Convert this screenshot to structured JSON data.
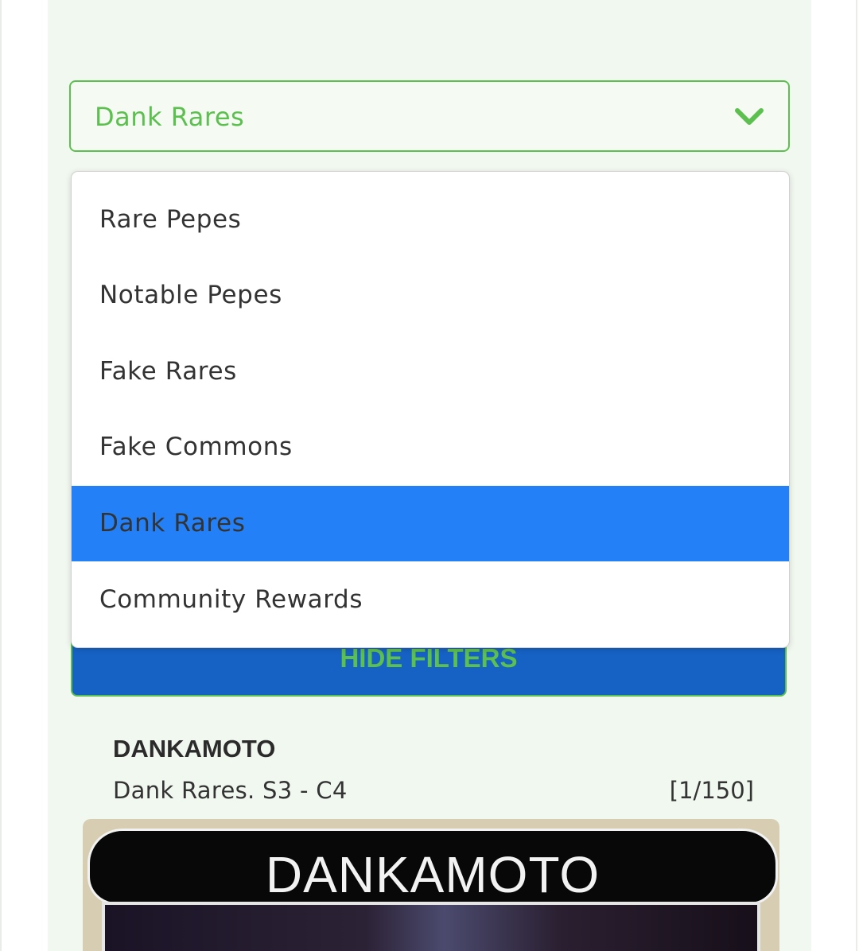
{
  "filter_select": {
    "selected": "Dank Rares",
    "icon": "chevron-down-icon",
    "options": [
      "Rare Pepes",
      "Notable Pepes",
      "Fake Rares",
      "Fake Commons",
      "Dank Rares",
      "Community Rewards"
    ]
  },
  "hide_filters_button": {
    "label": "HIDE FILTERS"
  },
  "card": {
    "title": "DANKAMOTO",
    "subtitle": "Dank Rares. S3 - C4",
    "count": "[1/150]",
    "image_banner": "DANKAMOTO"
  },
  "colors": {
    "accent_green": "#5cc04f",
    "selected_blue": "#2380f7",
    "button_blue": "#1662c4",
    "panel_bg": "#f1f8f0"
  }
}
